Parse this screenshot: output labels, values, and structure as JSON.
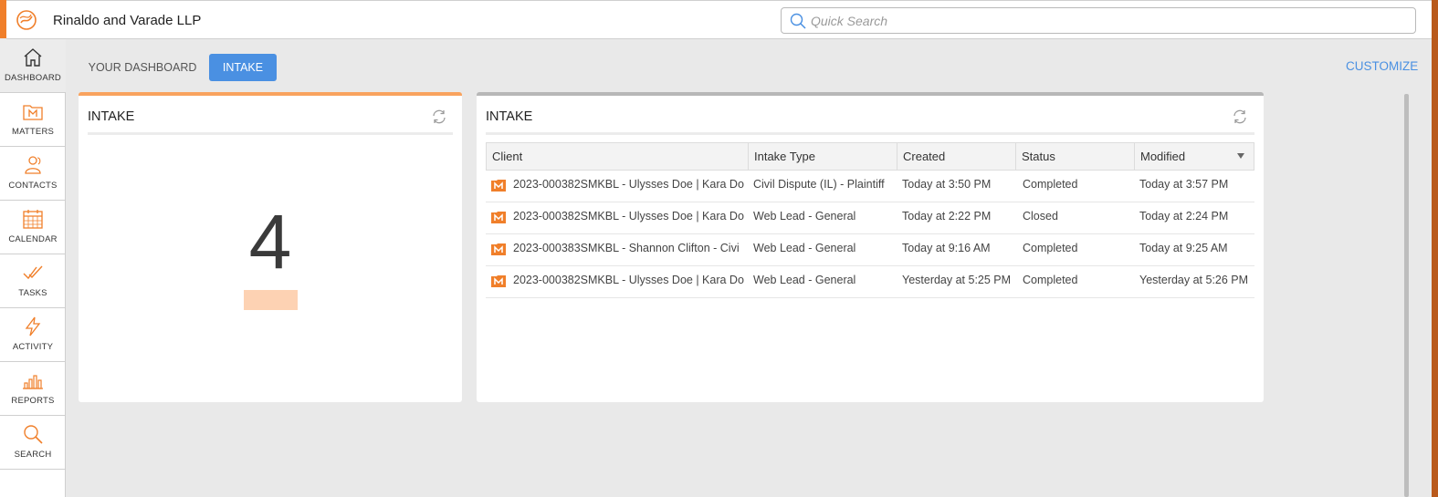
{
  "app": {
    "firm_name": "Rinaldo and Varade LLP",
    "accent": "#f07f2a",
    "link_color": "#4a90e2"
  },
  "search": {
    "placeholder": "Quick Search",
    "value": ""
  },
  "sidebar": {
    "items": [
      {
        "label": "DASHBOARD",
        "icon": "home-icon",
        "active": true
      },
      {
        "label": "MATTERS",
        "icon": "matters-icon",
        "active": false
      },
      {
        "label": "CONTACTS",
        "icon": "contacts-icon",
        "active": false
      },
      {
        "label": "CALENDAR",
        "icon": "calendar-icon",
        "active": false
      },
      {
        "label": "TASKS",
        "icon": "tasks-icon",
        "active": false
      },
      {
        "label": "ACTIVITY",
        "icon": "activity-icon",
        "active": false
      },
      {
        "label": "REPORTS",
        "icon": "reports-icon",
        "active": false
      },
      {
        "label": "SEARCH",
        "icon": "search-icon",
        "active": false
      }
    ]
  },
  "tabs": {
    "your_dashboard": "YOUR DASHBOARD",
    "intake": "INTAKE",
    "customize": "CUSTOMIZE"
  },
  "widget_count": {
    "title": "INTAKE",
    "count": "4"
  },
  "widget_table": {
    "title": "INTAKE",
    "columns": [
      "Client",
      "Intake Type",
      "Created",
      "Status",
      "Modified"
    ],
    "rows": [
      [
        "2023-000382SMKBL - Ulysses Doe | Kara Do",
        "Civil Dispute (IL) - Plaintiff",
        "Today at 3:50 PM",
        "Completed",
        "Today at 3:57 PM"
      ],
      [
        "2023-000382SMKBL - Ulysses Doe | Kara Do",
        "Web Lead - General",
        "Today at 2:22 PM",
        "Closed",
        "Today at 2:24 PM"
      ],
      [
        "2023-000383SMKBL - Shannon Clifton - Civi",
        "Web Lead - General",
        "Today at 9:16 AM",
        "Completed",
        "Today at 9:25 AM"
      ],
      [
        "2023-000382SMKBL - Ulysses Doe | Kara Do",
        "Web Lead - General",
        "Yesterday at 5:25 PM",
        "Completed",
        "Yesterday at 5:26 PM"
      ]
    ]
  }
}
